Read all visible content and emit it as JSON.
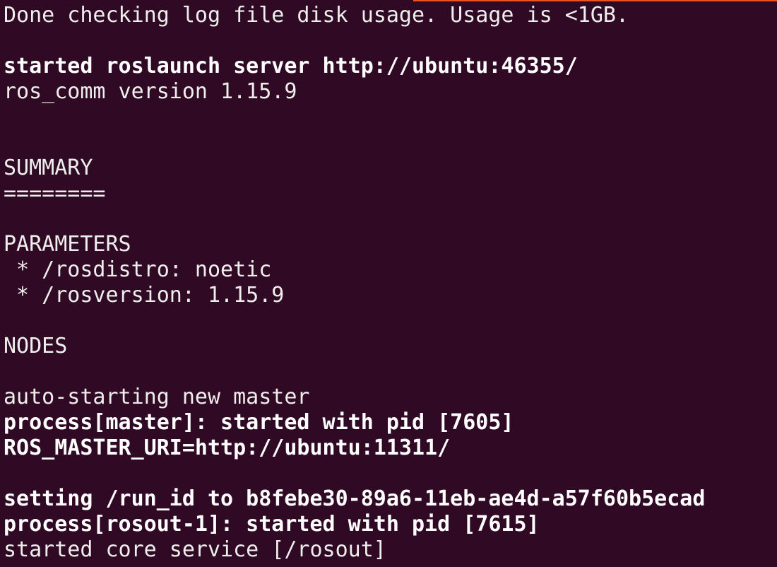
{
  "terminal": {
    "background": "#300a24",
    "foreground": "#eeeeec",
    "accent": "#e95420",
    "lines": [
      {
        "text": "Done checking log file disk usage. Usage is <1GB.",
        "bold": false
      },
      {
        "text": "",
        "bold": false
      },
      {
        "text": "started roslaunch server http://ubuntu:46355/",
        "bold": true
      },
      {
        "text": "ros_comm version 1.15.9",
        "bold": false
      },
      {
        "text": "",
        "bold": false
      },
      {
        "text": "",
        "bold": false
      },
      {
        "text": "SUMMARY",
        "bold": false
      },
      {
        "text": "========",
        "bold": false
      },
      {
        "text": "",
        "bold": false
      },
      {
        "text": "PARAMETERS",
        "bold": false
      },
      {
        "text": " * /rosdistro: noetic",
        "bold": false
      },
      {
        "text": " * /rosversion: 1.15.9",
        "bold": false
      },
      {
        "text": "",
        "bold": false
      },
      {
        "text": "NODES",
        "bold": false
      },
      {
        "text": "",
        "bold": false
      },
      {
        "text": "auto-starting new master",
        "bold": false
      },
      {
        "text": "process[master]: started with pid [7605]",
        "bold": true
      },
      {
        "text": "ROS_MASTER_URI=http://ubuntu:11311/",
        "bold": true
      },
      {
        "text": "",
        "bold": false
      },
      {
        "text": "setting /run_id to b8febe30-89a6-11eb-ae4d-a57f60b5ecad",
        "bold": true
      },
      {
        "text": "process[rosout-1]: started with pid [7615]",
        "bold": true
      },
      {
        "text": "started core service [/rosout]",
        "bold": false
      }
    ]
  }
}
